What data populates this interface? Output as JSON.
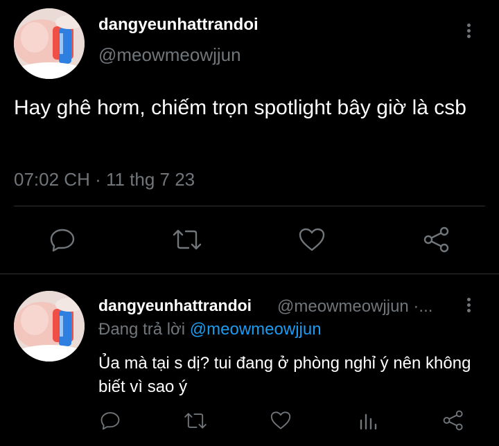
{
  "main_tweet": {
    "display_name": "dangyeunhattrandoi",
    "handle": "@meowmeowjjun",
    "text": "Hay ghê hơm, chiếm trọn spotlight bây giờ là csb",
    "time": "07:02 CH",
    "separator": " · ",
    "date": "11 thg 7 23",
    "actions": [
      "reply-icon",
      "retweet-icon",
      "like-icon",
      "share-icon"
    ]
  },
  "reply_tweet": {
    "display_name": "dangyeunhattrandoi",
    "handle_truncated": "@meowmeowjjun ·...",
    "replying_prefix": "Đang trả lời",
    "replying_to": "@meowmeowjjun",
    "text": "Ủa mà tại s dị? tui đang ở phòng nghỉ ý nên không biết vì sao ý",
    "actions": [
      "reply-icon",
      "retweet-icon",
      "like-icon",
      "analytics-icon",
      "share-icon"
    ]
  },
  "colors": {
    "background": "#000000",
    "text_primary": "#ffffff",
    "text_secondary": "#71767b",
    "link": "#1d9bf0",
    "divider": "#2f3336"
  }
}
